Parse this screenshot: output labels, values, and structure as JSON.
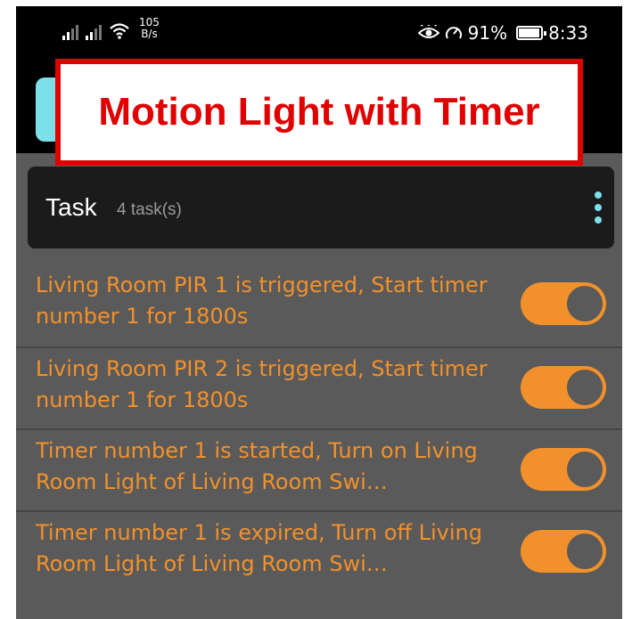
{
  "status_bar": {
    "net_speed_value": "105",
    "net_speed_unit": "B/s",
    "battery": "91%",
    "time": "8:33",
    "icons": [
      "signal-icon",
      "signal-icon",
      "wifi-icon",
      "eye-icon",
      "speed-gauge-icon",
      "battery-icon"
    ]
  },
  "banner": {
    "title": "Motion Light with Timer",
    "border_color": "#e00000"
  },
  "task_header": {
    "title": "Task",
    "count": "4 task(s)"
  },
  "tasks": [
    {
      "text": "Living Room PIR 1 is triggered, Start timer number 1 for 1800s",
      "enabled": true
    },
    {
      "text": "Living Room PIR 2 is triggered, Start timer number 1 for 1800s",
      "enabled": true
    },
    {
      "text": "Timer number 1 is started, Turn on Living Room Light of Living Room Swi…",
      "enabled": true
    },
    {
      "text": "Timer number 1 is expired, Turn off Living Room Light of Living Room Swi…",
      "enabled": true
    }
  ],
  "colors": {
    "accent": "#f2912b",
    "teal": "#7ddfe8",
    "background": "#5a5a5a"
  }
}
